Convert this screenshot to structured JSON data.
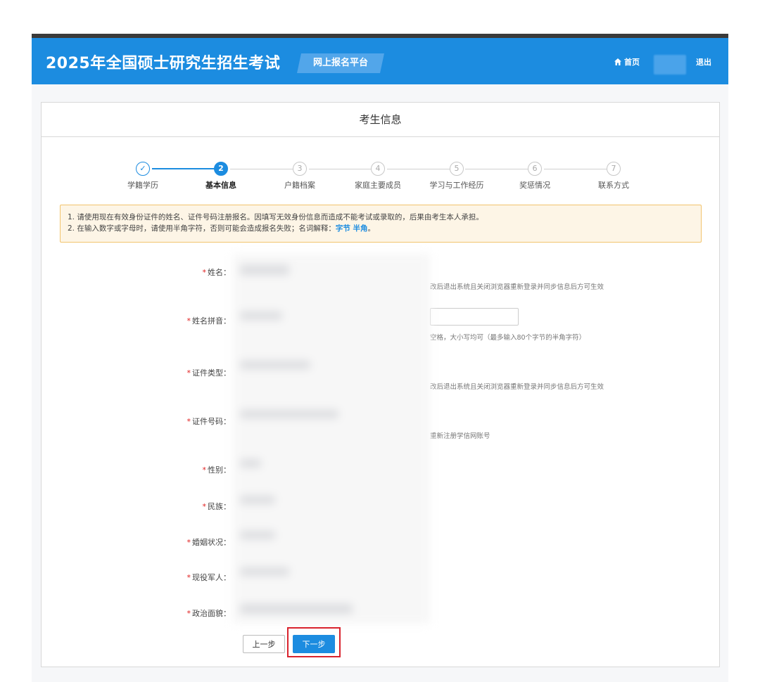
{
  "header": {
    "title": "2025年全国硕士研究生招生考试",
    "subtitle": "网上报名平台",
    "home_label": "首页",
    "logout_label": "退出",
    "color": "#1c8ce0"
  },
  "panel": {
    "title": "考生信息"
  },
  "steps": [
    {
      "num": "✓",
      "label": "学籍学历",
      "state": "done"
    },
    {
      "num": "2",
      "label": "基本信息",
      "state": "active"
    },
    {
      "num": "3",
      "label": "户籍档案",
      "state": "pending"
    },
    {
      "num": "4",
      "label": "家庭主要成员",
      "state": "pending"
    },
    {
      "num": "5",
      "label": "学习与工作经历",
      "state": "pending"
    },
    {
      "num": "6",
      "label": "奖惩情况",
      "state": "pending"
    },
    {
      "num": "7",
      "label": "联系方式",
      "state": "pending"
    }
  ],
  "notice": {
    "line1": "1. 请使用现在有效身份证件的姓名、证件号码注册报名。因填写无效身份信息而造成不能考试或录取的，后果由考生本人承担。",
    "line2_prefix": "2. 在输入数字或字母时，请使用半角字符，否则可能会造成报名失败；名词解释：",
    "link": "字节 半角",
    "line2_suffix": "。"
  },
  "form": {
    "fields": [
      {
        "label": "姓名："
      },
      {
        "label": "姓名拼音："
      },
      {
        "label": "证件类型："
      },
      {
        "label": "证件号码："
      },
      {
        "label": "性别："
      },
      {
        "label": "民族："
      },
      {
        "label": "婚姻状况："
      },
      {
        "label": "现役军人："
      },
      {
        "label": "政治面貌："
      }
    ],
    "required_mark": "*",
    "hints": {
      "name": "改后退出系统且关闭浏览器重新登录并同步信息后方可生效",
      "pinyin": "空格，大小写均可（最多输入80个字节的半角字符）",
      "idtype": "改后退出系统且关闭浏览器重新登录并同步信息后方可生效",
      "idnum": "重新注册学信网账号"
    }
  },
  "buttons": {
    "prev": "上一步",
    "next": "下一步"
  },
  "colors": {
    "accent": "#1c8ce0",
    "required": "#e02020",
    "highlight_frame": "#d9232d",
    "notice_bg": "#fdf5e6"
  }
}
